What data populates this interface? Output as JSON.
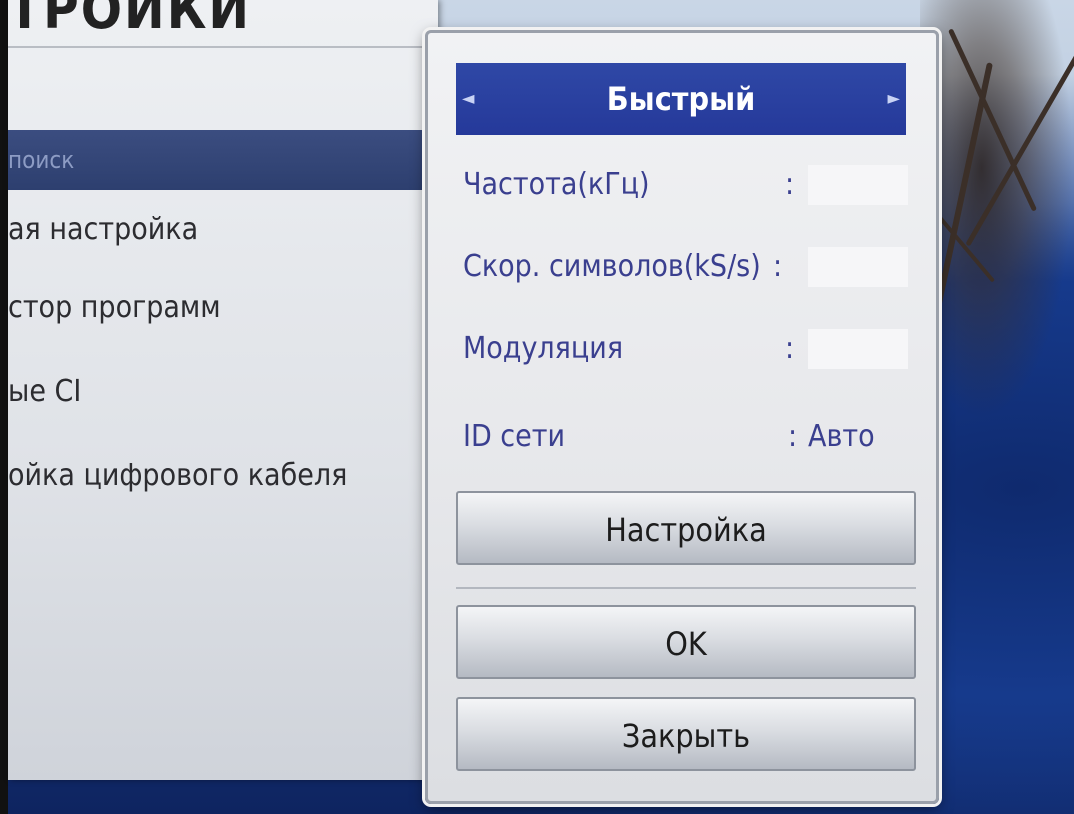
{
  "settings": {
    "title": "ТРОЙКИ",
    "menu": [
      {
        "label": "поиск",
        "active": true
      },
      {
        "label": "ая настройка"
      },
      {
        "label": "стор программ"
      },
      {
        "label": "ые CI"
      },
      {
        "label": "ойка цифрового кабеля"
      }
    ]
  },
  "dialog": {
    "mode": {
      "value": "Быстрый",
      "left_arrow": "◄",
      "right_arrow": "►"
    },
    "fields": [
      {
        "label": "Частота(кГц)",
        "colon": ":",
        "value": ""
      },
      {
        "label": "Скор. символов(kS/s)",
        "colon": ":",
        "value": ""
      },
      {
        "label": "Модуляция",
        "colon": ":",
        "value": ""
      },
      {
        "label": "ID сети",
        "colon": ":",
        "value": "Авто"
      }
    ],
    "buttons": {
      "setup": "Настройка",
      "ok": "OK",
      "close": "Закрыть"
    }
  }
}
